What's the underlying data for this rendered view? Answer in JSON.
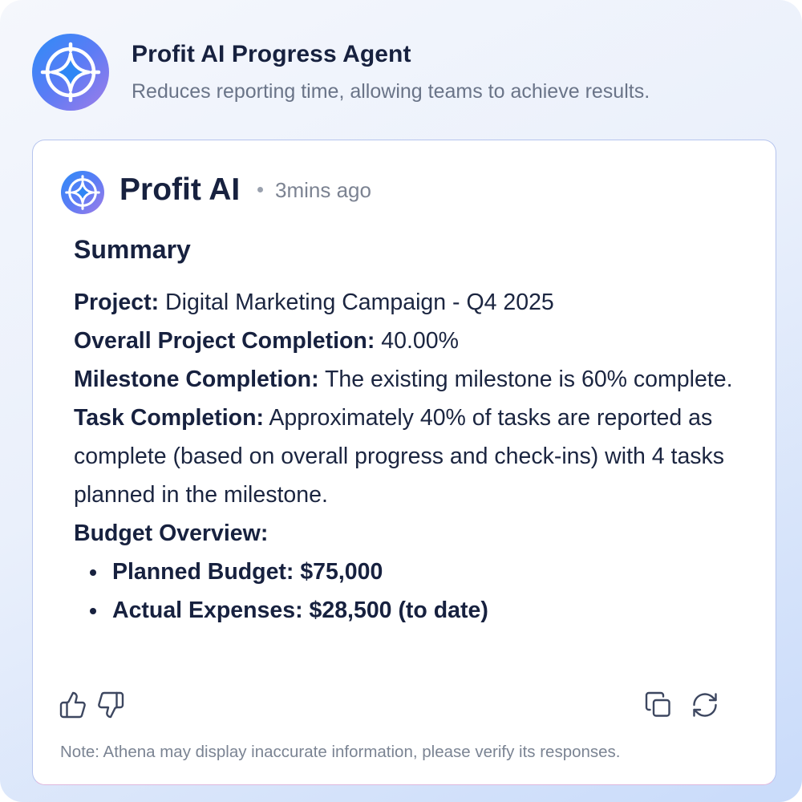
{
  "agent": {
    "title": "Profit AI Progress Agent",
    "subtitle": "Reduces reporting time, allowing teams to achieve results.",
    "logo_icon": "sparkle-compass-icon"
  },
  "message": {
    "sender": "Profit AI",
    "time": "3mins ago",
    "summary_title": "Summary",
    "project_label": "Project:",
    "project_value": "Digital Marketing Campaign - Q4 2025",
    "completion_label": "Overall Project Completion:",
    "completion_value": "40.00%",
    "milestone_label": "Milestone Completion:",
    "milestone_value": "The existing milestone is 60% complete.",
    "task_label": "Task Completion:",
    "task_value": "Approximately 40% of tasks are reported as complete (based on overall progress and check-ins) with 4 tasks planned in the milestone.",
    "budget_label": "Budget Overview:",
    "budget_items": [
      "Planned Budget: $75,000",
      "Actual Expenses: $28,500 (to date)"
    ]
  },
  "actions": {
    "icons": [
      "thumbs-up-icon",
      "thumbs-down-icon",
      "copy-icon",
      "regenerate-icon"
    ]
  },
  "note": "Note: Athena may display inaccurate information, please verify its responses.",
  "colors": {
    "accent_start": "#2e8cf7",
    "accent_end": "#a07de8",
    "text_primary": "#17213f",
    "text_muted": "#7b8493",
    "card_border": "#b6c4ee"
  }
}
